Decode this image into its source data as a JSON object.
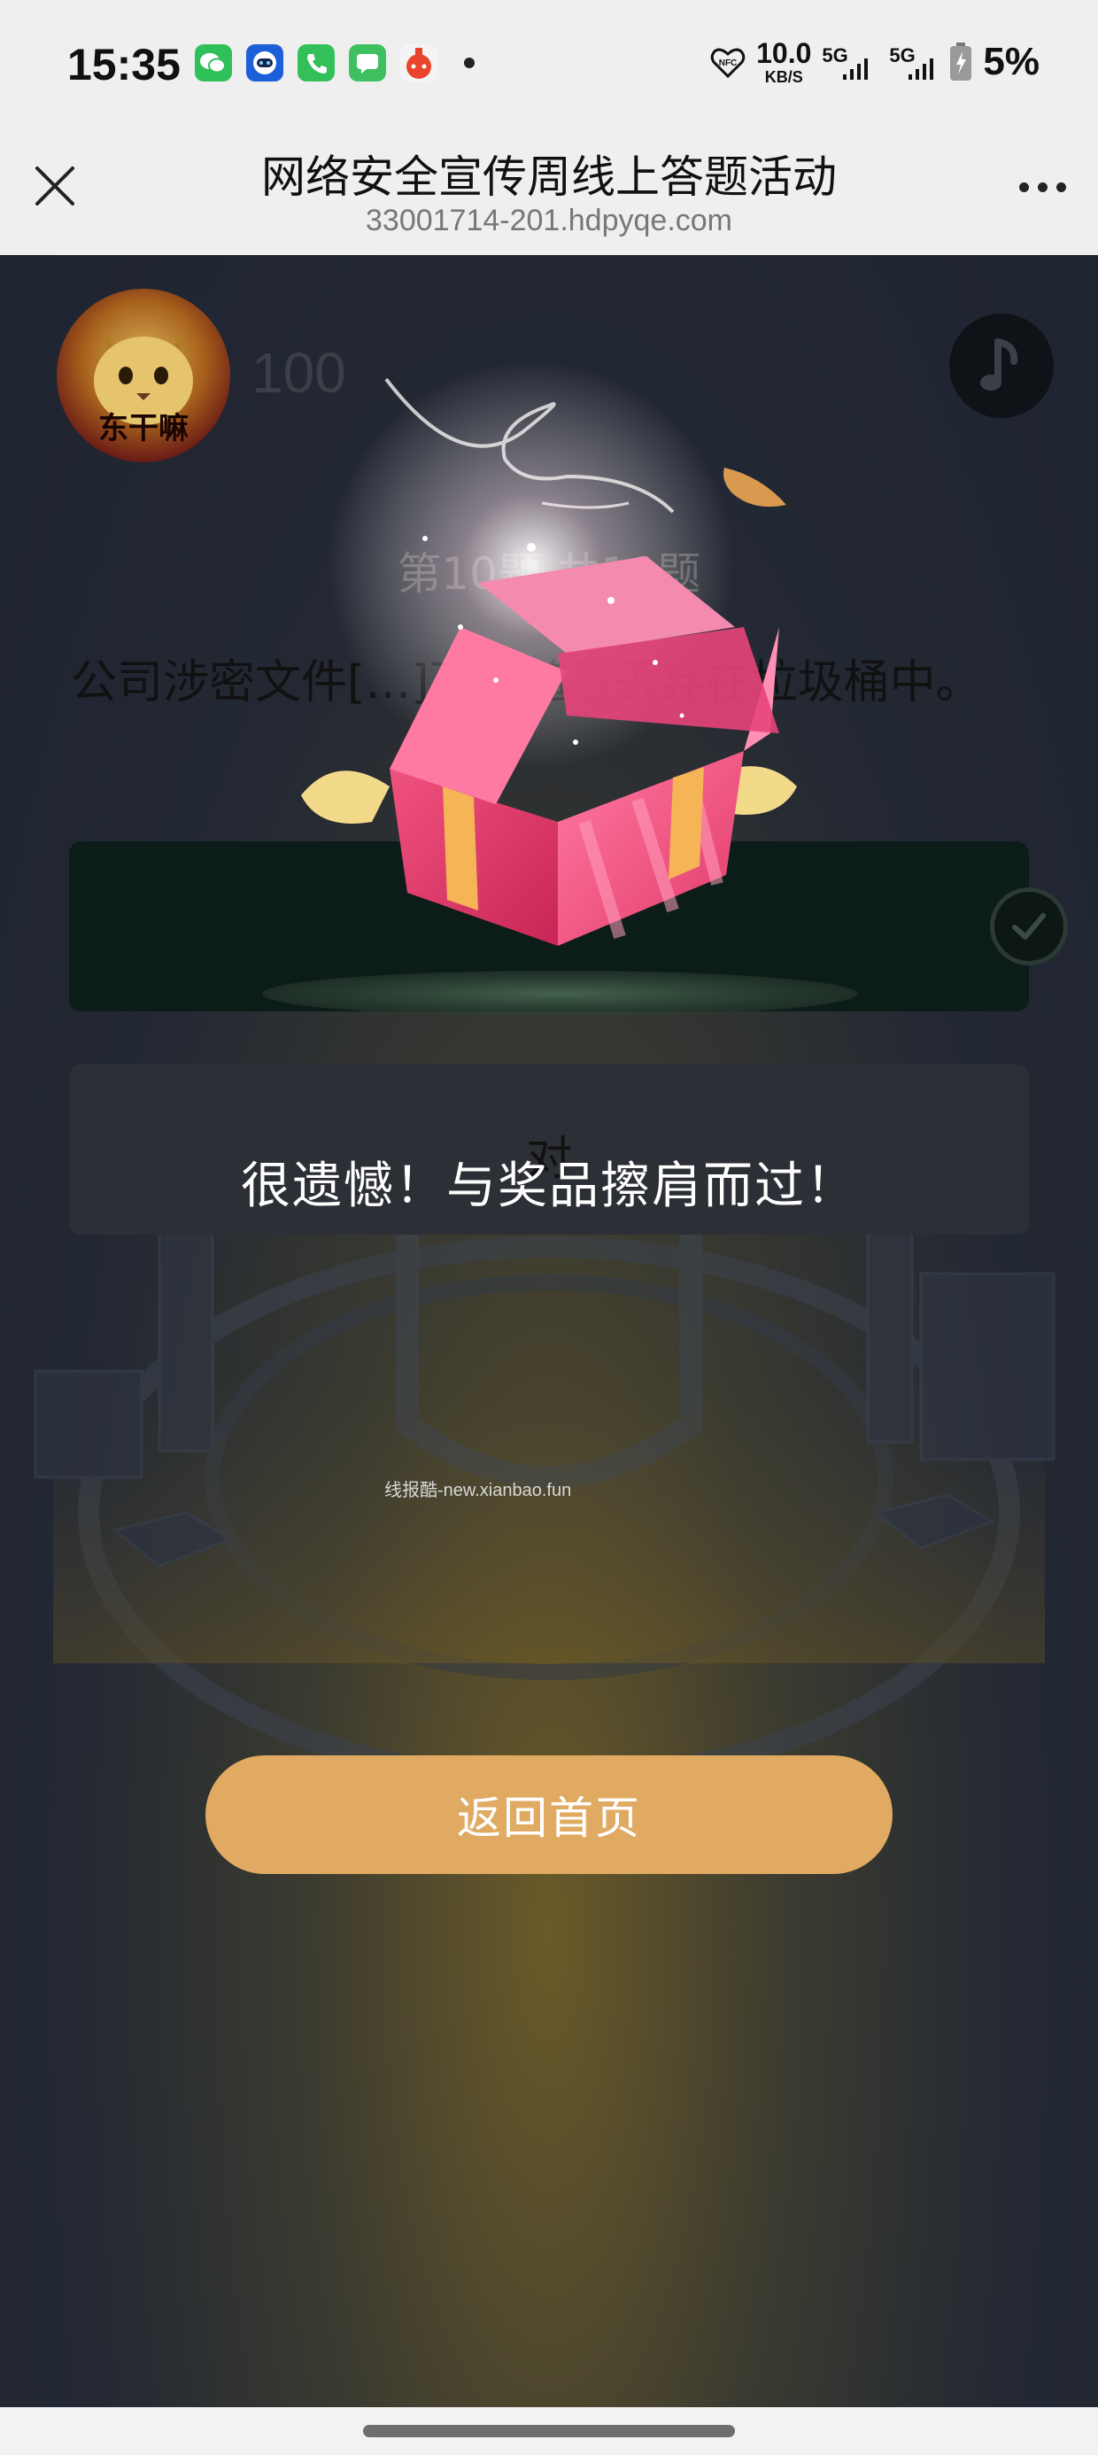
{
  "status_bar": {
    "time": "15:35",
    "speed_value": "10.0",
    "speed_unit": "KB/S",
    "nfc_label": "NFC",
    "net1": "5G",
    "net2": "5G",
    "battery": "5%",
    "apps": [
      "wechat-icon",
      "bot-icon",
      "phone-icon",
      "messages-icon",
      "game-icon"
    ]
  },
  "header": {
    "title": "网络安全宣传周线上答题活动",
    "url": "33001714-201.hdpyqe.com"
  },
  "quiz": {
    "avatar_text": "东干嘛",
    "score": "100",
    "progress": "第10题  共10题",
    "question": "公司涉密文件[…]可以随意丢弃在垃圾桶中。",
    "option_b": "对"
  },
  "popup": {
    "message": "很遗憾！与奖品擦肩而过！",
    "watermark": "线报酷-new.xianbao.fun",
    "home_button": "返回首页"
  },
  "colors": {
    "accent": "#e0aa62",
    "overlay": "#1f2530",
    "gift_pink": "#f2557e"
  }
}
